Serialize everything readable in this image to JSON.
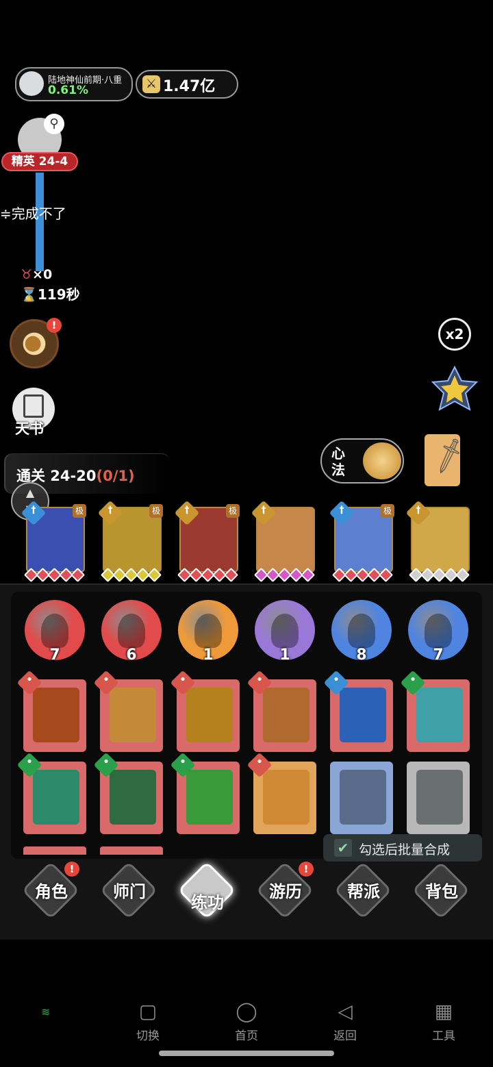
{
  "status": {
    "realm_name": "陆地神仙前期·八重",
    "realm_progress": "0.61%",
    "power": "1.47亿"
  },
  "stage": {
    "elite_label": "精英 24-4",
    "quest_text": "≑完成不了",
    "kills": "×0",
    "timer": "119秒"
  },
  "side": {
    "book_label": "天书",
    "alert": "!",
    "speed": "x2"
  },
  "progress": {
    "clear_label": "通关 24-20",
    "clear_count": "(0/1)"
  },
  "xinfa": {
    "label": "心法"
  },
  "equipped_skills": [
    {
      "icon": "water-element-icon",
      "elem_color": "#3a8fd6",
      "art": "#3b4fb0",
      "gem": "#e0505a",
      "tag": "极"
    },
    {
      "icon": "sword-element-icon",
      "elem_color": "#c9952e",
      "art": "#b9952f",
      "gem": "#d8c83a",
      "tag": "极"
    },
    {
      "icon": "sword-element-icon",
      "elem_color": "#c9952e",
      "art": "#9b3a30",
      "gem": "#e0505a",
      "tag": "极"
    },
    {
      "icon": "sword-element-icon",
      "elem_color": "#c9952e",
      "art": "#c7874a",
      "gem": "#d658c8",
      "tag": ""
    },
    {
      "icon": "water-element-icon",
      "elem_color": "#3a8fd6",
      "art": "#5c7fd0",
      "gem": "#e0505a",
      "tag": "极"
    },
    {
      "icon": "sword-element-icon",
      "elem_color": "#c9952e",
      "art": "#d0a84a",
      "gem": "#cfcfcf",
      "tag": ""
    }
  ],
  "orbs": [
    {
      "count": "7",
      "color": "#e24b4b"
    },
    {
      "count": "6",
      "color": "#e24b4b"
    },
    {
      "count": "1",
      "color": "#ef9a3a"
    },
    {
      "count": "1",
      "color": "#9a78d8"
    },
    {
      "count": "8",
      "color": "#4f84e0"
    },
    {
      "count": "7",
      "color": "#4f84e0"
    }
  ],
  "skill_books_row1": [
    {
      "icon": "person-element-icon",
      "elem": "#d8574c",
      "spine": "#d86a6a",
      "pic": "#a64a1e"
    },
    {
      "icon": "person-element-icon",
      "elem": "#d8574c",
      "spine": "#d86a6a",
      "pic": "#c48a3a"
    },
    {
      "icon": "person-element-icon",
      "elem": "#d8574c",
      "spine": "#d86a6a",
      "pic": "#b5801e"
    },
    {
      "icon": "person-element-icon",
      "elem": "#d8574c",
      "spine": "#d86a6a",
      "pic": "#b06a30"
    },
    {
      "icon": "water-element-icon",
      "elem": "#3a8fd6",
      "spine": "#d86a6a",
      "pic": "#2b62b8"
    },
    {
      "icon": "leaf-element-icon",
      "elem": "#2aa04a",
      "spine": "#d86a6a",
      "pic": "#3fa0a8"
    }
  ],
  "skill_books_row2": [
    {
      "icon": "leaf-element-icon",
      "elem": "#2aa04a",
      "spine": "#d86a6a",
      "pic": "#2d8a6a"
    },
    {
      "icon": "leaf-element-icon",
      "elem": "#2aa04a",
      "spine": "#d86a6a",
      "pic": "#2f6a40"
    },
    {
      "icon": "leaf-element-icon",
      "elem": "#2aa04a",
      "spine": "#d86a6a",
      "pic": "#3a9a3a"
    },
    {
      "icon": "person-element-icon",
      "elem": "#d8574c",
      "spine": "#e0a55a",
      "pic": "#d08a36"
    },
    {
      "icon": "",
      "elem": "",
      "spine": "#8aa6d6",
      "pic": "#5a6a8a"
    },
    {
      "icon": "",
      "elem": "",
      "spine": "#b8b8b8",
      "pic": "#6a7070"
    }
  ],
  "batch": {
    "label": "勾选后批量合成",
    "checked": true
  },
  "nav": [
    {
      "label": "角色",
      "badge": true,
      "active": false
    },
    {
      "label": "师门",
      "badge": false,
      "active": false
    },
    {
      "label": "练功",
      "badge": false,
      "active": true
    },
    {
      "label": "游历",
      "badge": true,
      "active": false
    },
    {
      "label": "帮派",
      "badge": false,
      "active": false
    },
    {
      "label": "背包",
      "badge": false,
      "active": false
    }
  ],
  "system_nav": [
    {
      "label": "切换",
      "icon": "square-icon"
    },
    {
      "label": "首页",
      "icon": "circle-icon"
    },
    {
      "label": "返回",
      "icon": "triangle-back-icon"
    },
    {
      "label": "工具",
      "icon": "grid-icon"
    }
  ]
}
